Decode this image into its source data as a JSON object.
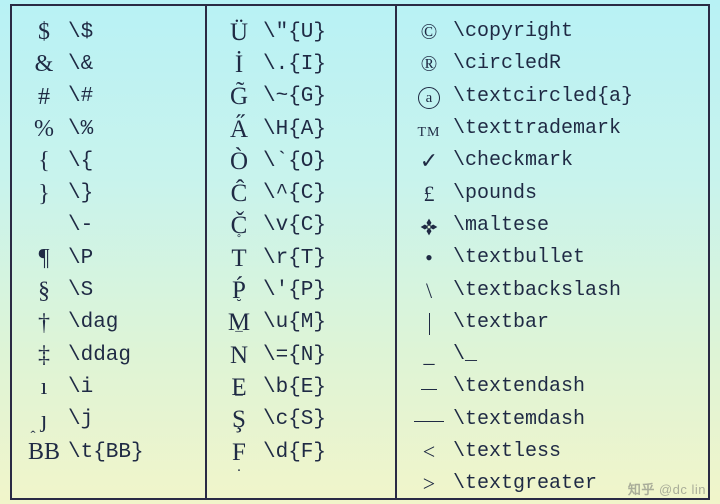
{
  "col1": [
    {
      "sym": "$",
      "cmd": "\\$"
    },
    {
      "sym": "&",
      "cmd": "\\&"
    },
    {
      "sym": "#",
      "cmd": "\\#"
    },
    {
      "sym": "%",
      "cmd": "\\%"
    },
    {
      "sym": "{",
      "cmd": "\\{"
    },
    {
      "sym": "}",
      "cmd": "\\}"
    },
    {
      "sym": "",
      "cmd": "\\-"
    },
    {
      "sym": "¶",
      "cmd": "\\P"
    },
    {
      "sym": "§",
      "cmd": "\\S"
    },
    {
      "sym": "†",
      "cmd": "\\dag"
    },
    {
      "sym": "‡",
      "cmd": "\\ddag"
    },
    {
      "sym": "ı",
      "cmd": "\\i"
    },
    {
      "sym": "ȷ",
      "cmd": "\\j"
    },
    {
      "sym_html": "<span class='accent-wrap bb'><span class='acc'>ˆ</span>B</span>B",
      "cmd": "\\t{BB}"
    }
  ],
  "col2": [
    {
      "sym": "Ü",
      "cmd": "\\\"{U}"
    },
    {
      "sym": "İ",
      "cmd": "\\.{I}"
    },
    {
      "sym": "G̃",
      "cmd": "\\~{G}"
    },
    {
      "sym": "A̋",
      "cmd": "\\H{A}"
    },
    {
      "sym": "Ò",
      "cmd": "\\`{O}"
    },
    {
      "sym": "Ĉ",
      "cmd": "\\^{C}"
    },
    {
      "sym": "Č",
      "cmd": "\\v{C}"
    },
    {
      "sym_html": "<span class='accent-wrap'><span class='acc'>˚</span>T</span>",
      "cmd": "\\r{T}"
    },
    {
      "sym": "Ṕ",
      "cmd": "\\'{P}"
    },
    {
      "sym_html": "<span class='accent-wrap'><span class='acc'>˘</span>M</span>",
      "cmd": "\\u{M}"
    },
    {
      "sym_html": "<span class='accent-wrap'><span class='acc'>¯</span>N</span>",
      "cmd": "\\={N}"
    },
    {
      "sym_html": "<span class='accent-wrap'>E<span class='acc low'>¯</span></span>",
      "cmd": "\\b{E}"
    },
    {
      "sym": "Ş",
      "cmd": "\\c{S}"
    },
    {
      "sym_html": "<span class='accent-wrap'>F<span class='acc low'>.</span></span>",
      "cmd": "\\d{F}"
    }
  ],
  "col3": [
    {
      "sym": "©",
      "cmd": "\\copyright"
    },
    {
      "sym": "®",
      "cmd": "\\circledR"
    },
    {
      "sym_html": "<span class='circled'>a</span>",
      "cmd": "\\textcircled{a}"
    },
    {
      "sym_html": "<span class='tm'>TM</span>",
      "cmd": "\\texttrademark"
    },
    {
      "sym": "✓",
      "cmd": "\\checkmark"
    },
    {
      "sym": "£",
      "cmd": "\\pounds"
    },
    {
      "sym_html": "<span class='malt'><svg viewBox='0 0 24 24'><path fill='#1f2a44' d='M12 2 L9 7 L12 12 L15 7 Z M2 12 L7 9 L12 12 L7 15 Z M22 12 L17 15 L12 12 L17 9 Z M12 22 L15 17 L12 12 L9 17 Z'/><circle cx='12' cy='12' r='2.2' fill='#d8eed0' stroke='#1f2a44' stroke-width='1'/></svg></span>",
      "cmd": "\\maltese"
    },
    {
      "sym": "•",
      "cmd": "\\textbullet"
    },
    {
      "sym": "\\",
      "cmd": "\\textbackslash"
    },
    {
      "sym_html": "<span class='vbar'></span>",
      "cmd": "\\textbar"
    },
    {
      "sym": "_",
      "cmd": "\\_"
    },
    {
      "sym_html": "<span class='end'></span>",
      "cmd": "\\textendash"
    },
    {
      "sym_html": "<span class='emd'></span>",
      "cmd": "\\textemdash"
    },
    {
      "sym": "<",
      "cmd": "\\textless"
    },
    {
      "sym": ">",
      "cmd": "\\textgreater"
    }
  ],
  "watermark": {
    "brand": "知乎",
    "author": "@dc lin"
  }
}
